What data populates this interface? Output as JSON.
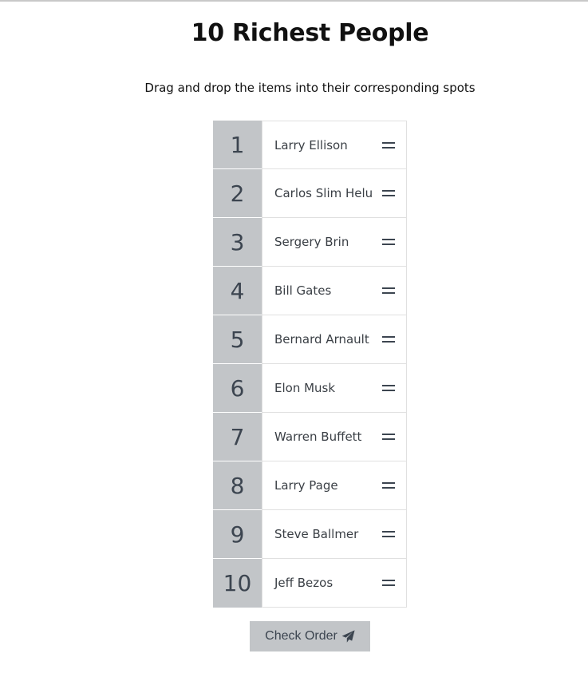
{
  "page": {
    "title": "10 Richest People",
    "instructions": "Drag and drop the items into their corresponding spots"
  },
  "ranking": {
    "numbers": [
      "1",
      "2",
      "3",
      "4",
      "5",
      "6",
      "7",
      "8",
      "9",
      "10"
    ],
    "people": [
      "Larry Ellison",
      "Carlos Slim Helu",
      "Sergery Brin",
      "Bill Gates",
      "Bernard Arnault",
      "Elon Musk",
      "Warren Buffett",
      "Larry Page",
      "Steve Ballmer",
      "Jeff Bezos"
    ],
    "handle_icon": "drag-handle-icon"
  },
  "actions": {
    "check_label": "Check Order",
    "check_icon": "paper-plane-icon"
  },
  "colors": {
    "accent": "#c2c5c8",
    "text_dark": "#3c4550"
  }
}
